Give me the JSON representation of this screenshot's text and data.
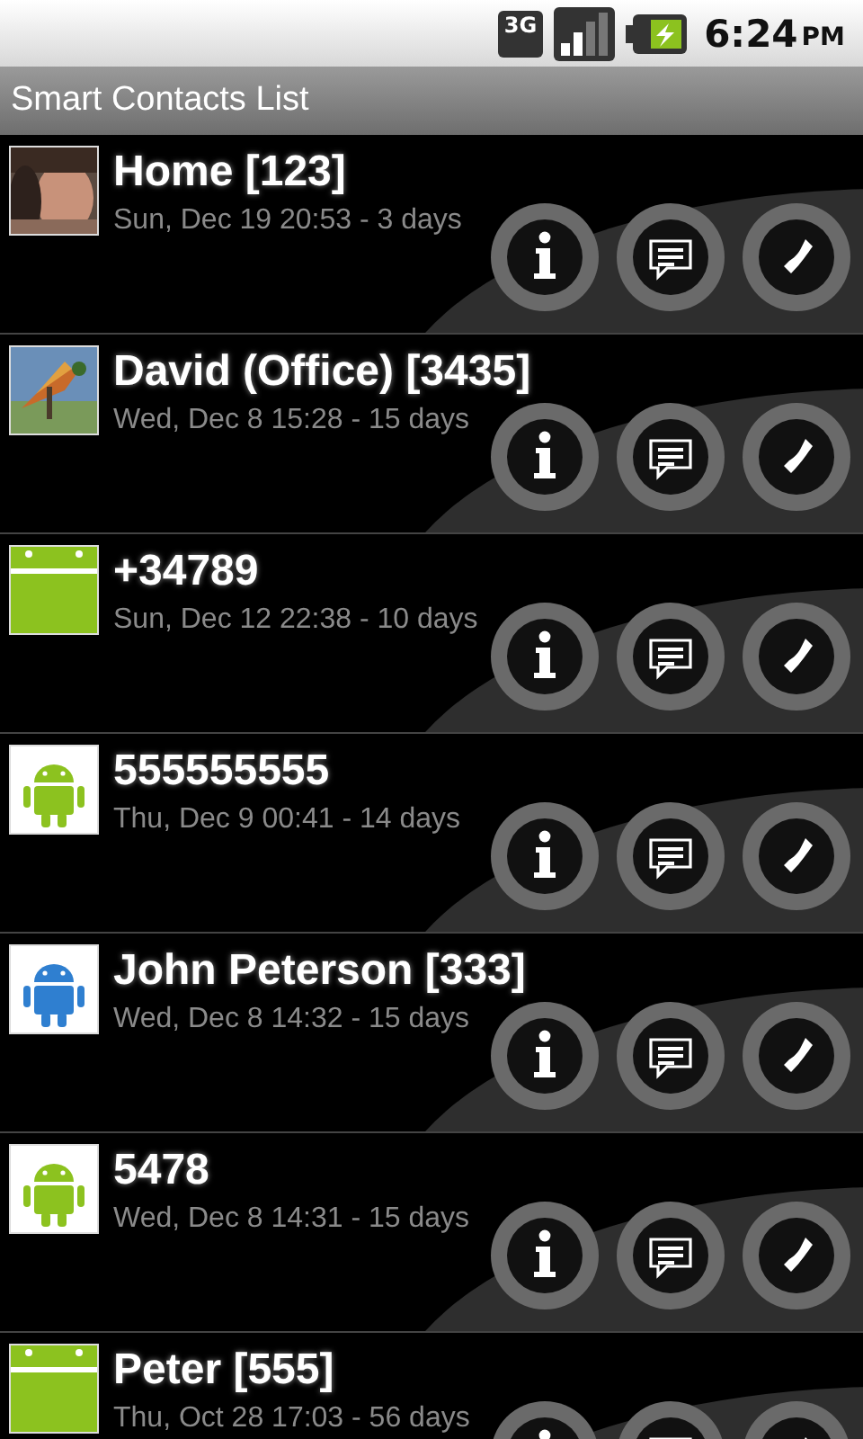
{
  "status_bar": {
    "time": "6:24",
    "ampm": "PM",
    "network": "3G"
  },
  "title_bar": {
    "title": "Smart Contacts List"
  },
  "contacts": [
    {
      "name": "Home [123]",
      "last_call": "Sun, Dec 19 20:53 - 3 days"
    },
    {
      "name": "David (Office) [3435]",
      "last_call": "Wed, Dec 8 15:28 - 15 days"
    },
    {
      "name": "+34789",
      "last_call": "Sun, Dec 12 22:38 - 10 days",
      "avatar": {
        "kind": "android-crop",
        "color": "#8cc21f"
      }
    },
    {
      "name": "555555555",
      "last_call": "Thu, Dec 9 00:41 - 14 days",
      "avatar": {
        "kind": "android",
        "color": "#8cc21f"
      }
    },
    {
      "name": "John Peterson [333]",
      "last_call": "Wed, Dec 8 14:32 - 15 days",
      "avatar": {
        "kind": "android",
        "color": "#2f7fd0"
      }
    },
    {
      "name": "5478",
      "last_call": "Wed, Dec 8 14:31 - 15 days",
      "avatar": {
        "kind": "android",
        "color": "#8cc21f"
      }
    },
    {
      "name": "Peter [555]",
      "last_call": "Thu, Oct 28 17:03 - 56 days",
      "avatar": {
        "kind": "android-crop",
        "color": "#8cc21f"
      }
    }
  ]
}
